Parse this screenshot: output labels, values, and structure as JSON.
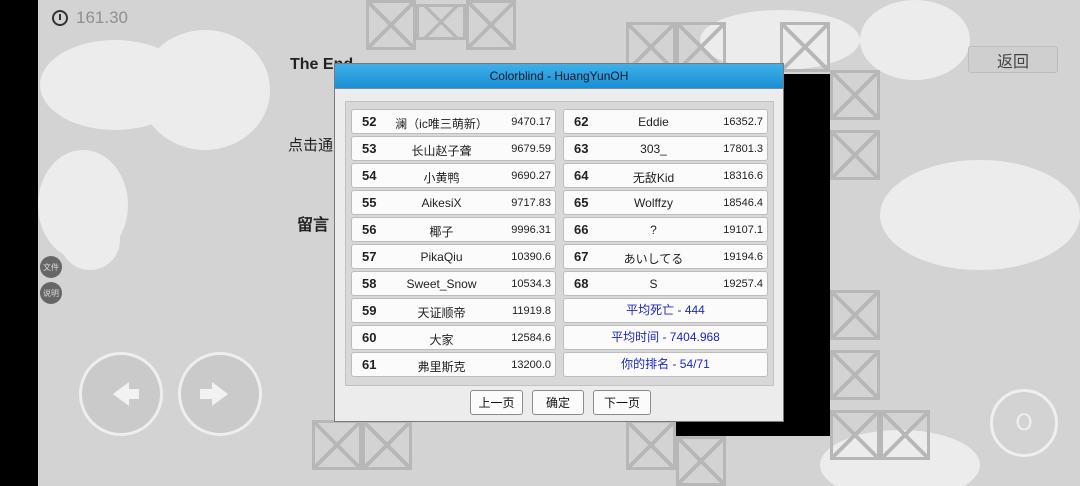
{
  "timer": "161.30",
  "background_texts": {
    "heading_partial": "The End",
    "left_hint": "点击通",
    "left_label": "留言",
    "small_btn_1": "文件",
    "small_btn_2": "说明"
  },
  "top_right": {
    "back_label": "返回"
  },
  "controls": {
    "jump_label": "O"
  },
  "dialog": {
    "title": "Colorblind - HuangYunOH",
    "left_rows": [
      {
        "rank": "52",
        "name": "澜（ic唯三萌新）",
        "score": "9470.17"
      },
      {
        "rank": "53",
        "name": "长山赵子聋",
        "score": "9679.59"
      },
      {
        "rank": "54",
        "name": "小黄鸭",
        "score": "9690.27"
      },
      {
        "rank": "55",
        "name": "AikesiX",
        "score": "9717.83"
      },
      {
        "rank": "56",
        "name": "椰子",
        "score": "9996.31"
      },
      {
        "rank": "57",
        "name": "PikaQiu",
        "score": "10390.6"
      },
      {
        "rank": "58",
        "name": "Sweet_Snow",
        "score": "10534.3"
      },
      {
        "rank": "59",
        "name": "天证顺帝",
        "score": "11919.8"
      },
      {
        "rank": "60",
        "name": "大家",
        "score": "12584.6"
      },
      {
        "rank": "61",
        "name": "弗里斯克",
        "score": "13200.0"
      }
    ],
    "right_rows": [
      {
        "rank": "62",
        "name": "Eddie",
        "score": "16352.7"
      },
      {
        "rank": "63",
        "name": "303_",
        "score": "17801.3"
      },
      {
        "rank": "64",
        "name": "无敌Kid",
        "score": "18316.6"
      },
      {
        "rank": "65",
        "name": "Wolffzy",
        "score": "18546.4"
      },
      {
        "rank": "66",
        "name": "?",
        "score": "19107.1"
      },
      {
        "rank": "67",
        "name": "あいしてる",
        "score": "19194.6"
      },
      {
        "rank": "68",
        "name": "S",
        "score": "19257.4"
      }
    ],
    "stats": {
      "avg_deaths": "平均死亡 - 444",
      "avg_time": "平均时间 - 7404.968",
      "your_rank": "你的排名 - 54/71"
    },
    "buttons": {
      "prev": "上一页",
      "ok": "确定",
      "next": "下一页"
    }
  }
}
